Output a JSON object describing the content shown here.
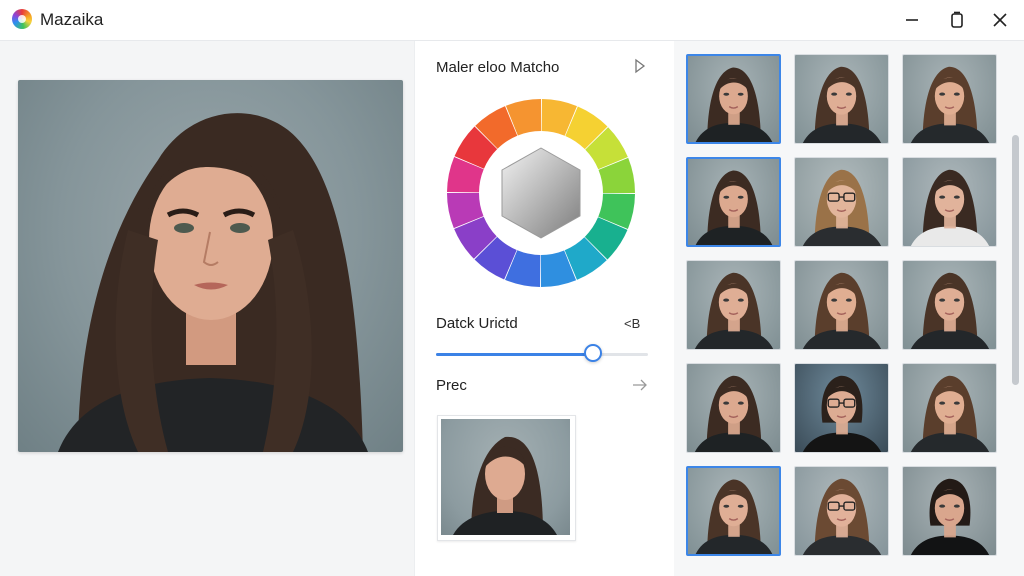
{
  "window": {
    "title": "Mazaika"
  },
  "controls": {
    "match_title": "Maler eloo Matcho",
    "blend_label": "Datck Urictd",
    "blend_value": "<B",
    "blend_level": 0.74,
    "preview_label": "Prec"
  },
  "colors": {
    "accent": "#3b82e6",
    "background": "#f7f8f9"
  },
  "grid": {
    "columns": 3,
    "selected": [
      0,
      3,
      12
    ],
    "variants": [
      "a",
      "b",
      "c",
      "a",
      "d",
      "e",
      "b",
      "c",
      "b",
      "a",
      "f",
      "c",
      "b",
      "g",
      "h"
    ]
  }
}
